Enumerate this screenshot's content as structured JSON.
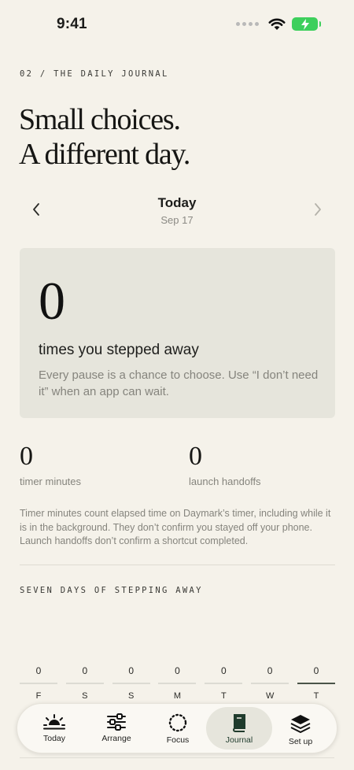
{
  "status_bar": {
    "time": "9:41"
  },
  "header": {
    "eyebrow": "02 / THE DAILY JOURNAL",
    "headline_line1": "Small choices.",
    "headline_line2": "A different day."
  },
  "day_nav": {
    "title": "Today",
    "date": "Sep 17"
  },
  "summary": {
    "count": "0",
    "heading": "times you stepped away",
    "body": "Every pause is a chance to choose. Use “I don’t need it” when an app can wait."
  },
  "stats": {
    "timer_minutes_value": "0",
    "timer_minutes_label": "timer minutes",
    "launch_handoffs_value": "0",
    "launch_handoffs_label": "launch handoffs"
  },
  "disclaimer": "Timer minutes count elapsed time on Daymark’s timer, including while it is in the background. They don’t confirm you stayed off your phone. Launch handoffs don’t confirm a shortcut completed.",
  "week": {
    "title": "SEVEN DAYS OF STEPPING AWAY",
    "days": [
      {
        "letter": "F",
        "value": "0"
      },
      {
        "letter": "S",
        "value": "0"
      },
      {
        "letter": "S",
        "value": "0"
      },
      {
        "letter": "M",
        "value": "0"
      },
      {
        "letter": "T",
        "value": "0"
      },
      {
        "letter": "W",
        "value": "0"
      },
      {
        "letter": "T",
        "value": "0"
      }
    ]
  },
  "tabs": [
    {
      "label": "Today",
      "icon": "sunrise-icon"
    },
    {
      "label": "Arrange",
      "icon": "sliders-icon"
    },
    {
      "label": "Focus",
      "icon": "dotted-circle-icon"
    },
    {
      "label": "Journal",
      "icon": "book-icon",
      "active": true
    },
    {
      "label": "Set up",
      "icon": "layers-icon"
    }
  ],
  "colors": {
    "background": "#f5f2ea",
    "card": "#e6e5dc",
    "accent": "#1f3b2c",
    "battery": "#3dcf5c"
  }
}
